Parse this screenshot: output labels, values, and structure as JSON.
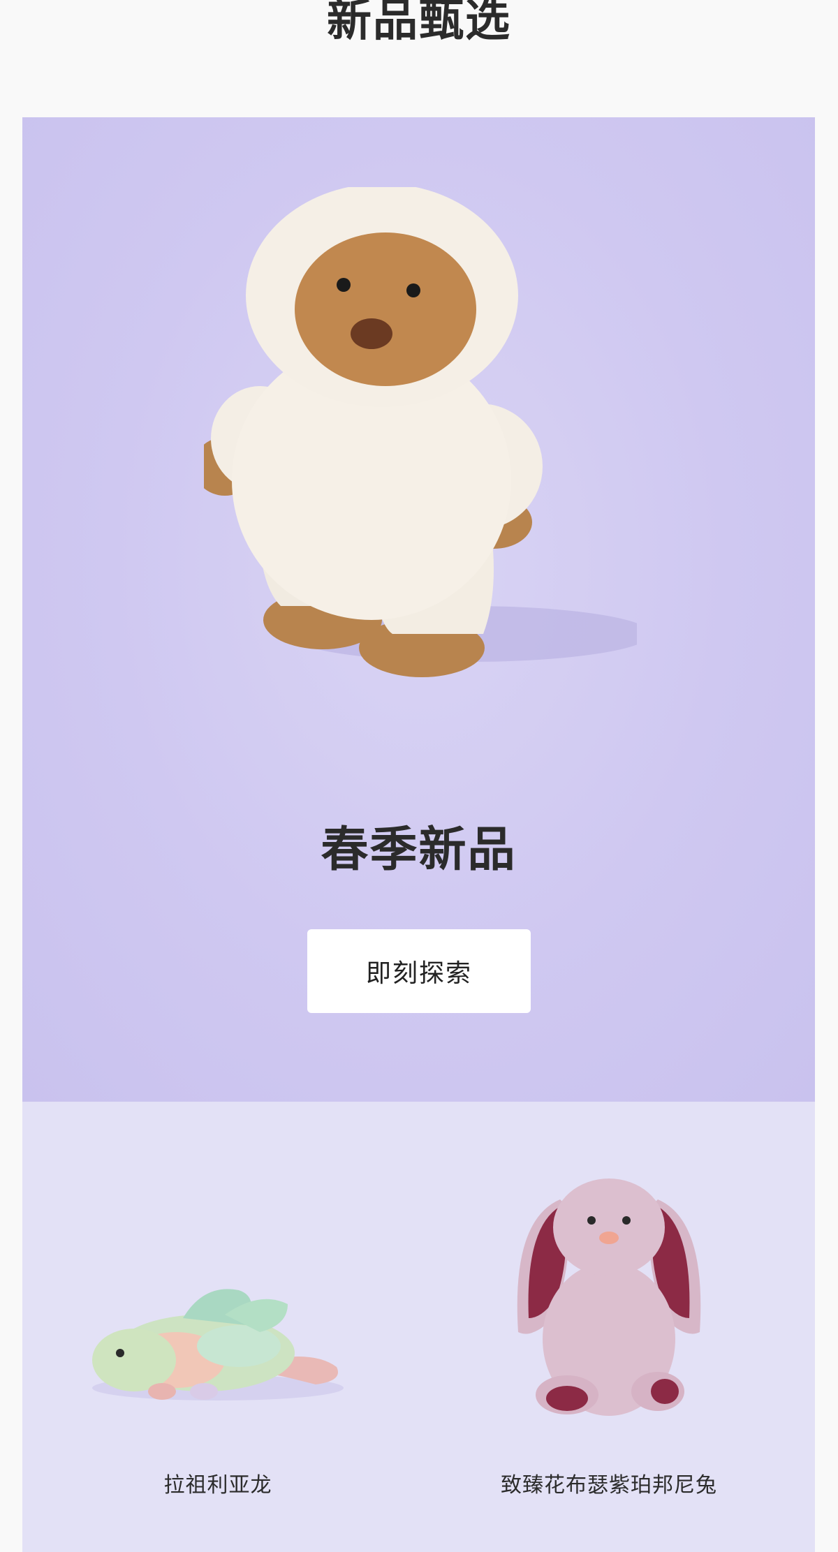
{
  "section": {
    "title": "新品甄选"
  },
  "hero": {
    "heading": "春季新品",
    "cta_label": "即刻探索",
    "background_color": "#cfc8f1"
  },
  "products": [
    {
      "name": "拉祖利亚龙"
    },
    {
      "name": "致臻花布瑟紫珀邦尼兔"
    }
  ],
  "colors": {
    "page_background": "#f9f9f9",
    "products_background": "#e3e1f6",
    "text": "#2b2b2b"
  }
}
